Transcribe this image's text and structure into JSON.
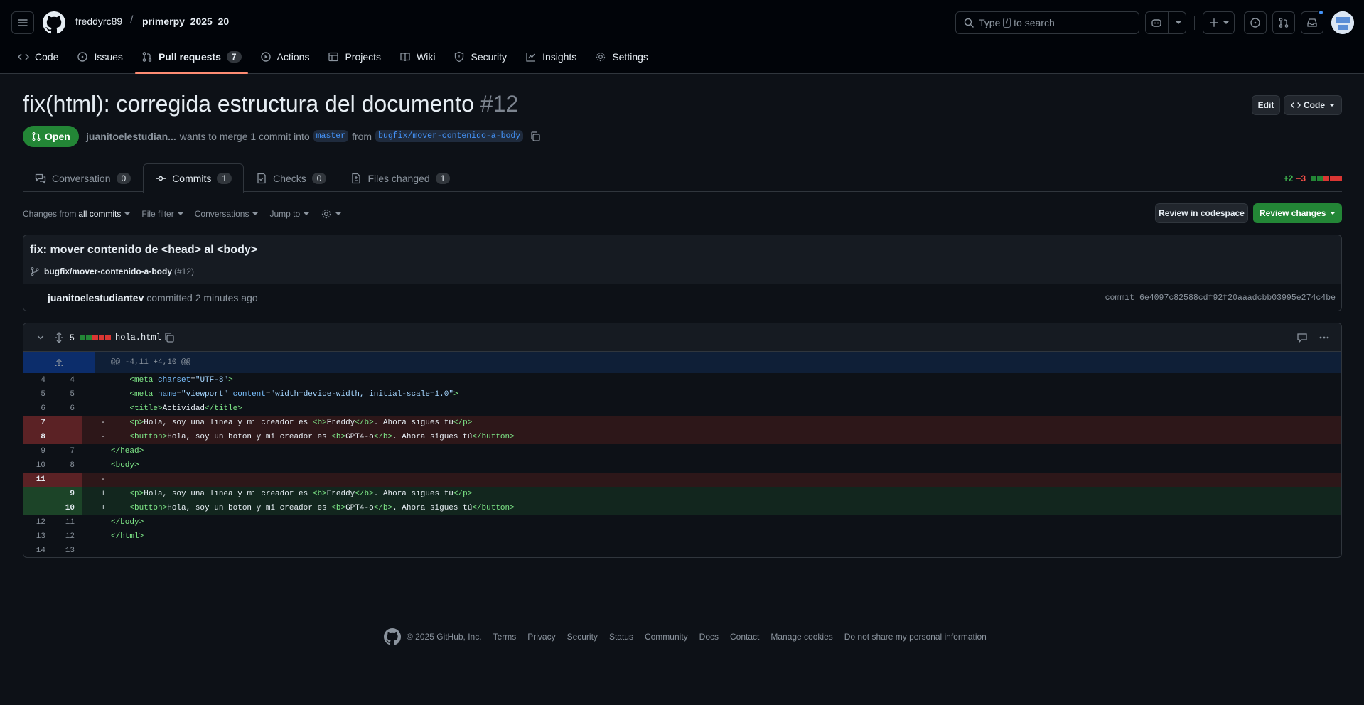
{
  "header": {
    "owner": "freddyrc89",
    "separator": "/",
    "repo": "primerpy_2025_20",
    "search": {
      "prefix": "Type",
      "key": "/",
      "suffix": "to search"
    }
  },
  "repo_nav": [
    {
      "label": "Code",
      "icon": "code-icon"
    },
    {
      "label": "Issues",
      "icon": "issue-icon"
    },
    {
      "label": "Pull requests",
      "icon": "pull-request-icon",
      "count": "7",
      "active": true
    },
    {
      "label": "Actions",
      "icon": "play-icon"
    },
    {
      "label": "Projects",
      "icon": "table-icon"
    },
    {
      "label": "Wiki",
      "icon": "book-icon"
    },
    {
      "label": "Security",
      "icon": "shield-icon"
    },
    {
      "label": "Insights",
      "icon": "graph-icon"
    },
    {
      "label": "Settings",
      "icon": "gear-icon"
    }
  ],
  "pr": {
    "title": "fix(html): corregida estructura del documento",
    "number": "#12",
    "edit_label": "Edit",
    "code_label": "Code",
    "state": "Open",
    "author": "juanitoelestudian...",
    "meta_text": "wants to merge 1 commit into",
    "base_branch": "master",
    "from_text": "from",
    "head_branch": "bugfix/mover-contenido-a-body"
  },
  "tabs": [
    {
      "label": "Conversation",
      "count": "0",
      "icon": "comment-discussion-icon"
    },
    {
      "label": "Commits",
      "count": "1",
      "icon": "commit-icon",
      "active": true
    },
    {
      "label": "Checks",
      "count": "0",
      "icon": "checklist-icon"
    },
    {
      "label": "Files changed",
      "count": "1",
      "icon": "file-diff-icon"
    }
  ],
  "diffstat": {
    "additions": "+2",
    "deletions": "−3"
  },
  "toolbar": {
    "changes_prefix": "Changes from",
    "changes_value": "all commits",
    "file_filter": "File filter",
    "conversations": "Conversations",
    "jump_to": "Jump to",
    "review_codespace": "Review in codespace",
    "review_changes": "Review changes"
  },
  "commit": {
    "message": "fix: mover contenido de <head> al <body>",
    "branch": "bugfix/mover-contenido-a-body",
    "pr_ref": "(#12)",
    "author": "juanitoelestudiantev",
    "action": "committed 2 minutes ago",
    "sha": "commit 6e4097c82588cdf92f20aaadcbb03995e274c4be"
  },
  "file": {
    "change_count": "5",
    "name": "hola.html",
    "hunk_header": "@@ -4,11 +4,10 @@"
  },
  "diff_rows": [
    {
      "type": "ctx",
      "old": "4",
      "new": "4",
      "html": "    <span class=\"tg\">&lt;meta</span> <span class=\"at\">charset</span>=<span class=\"st\">\"UTF-8\"</span><span class=\"tg\">&gt;</span>"
    },
    {
      "type": "ctx",
      "old": "5",
      "new": "5",
      "html": "    <span class=\"tg\">&lt;meta</span> <span class=\"at\">name</span>=<span class=\"st\">\"viewport\"</span> <span class=\"at\">content</span>=<span class=\"st\">\"width=device-width, initial-scale=1.0\"</span><span class=\"tg\">&gt;</span>"
    },
    {
      "type": "ctx",
      "old": "6",
      "new": "6",
      "html": "    <span class=\"tg\">&lt;title&gt;</span>Actividad<span class=\"tg\">&lt;/title&gt;</span>"
    },
    {
      "type": "del",
      "old": "7",
      "new": "",
      "html": "    <span class=\"tg\">&lt;p&gt;</span>Hola, soy una linea y mi creador es <span class=\"tg\">&lt;b&gt;</span>Freddy<span class=\"tg\">&lt;/b&gt;</span>. Ahora sigues tú<span class=\"tg\">&lt;/p&gt;</span>"
    },
    {
      "type": "del",
      "old": "8",
      "new": "",
      "html": "    <span class=\"tg\">&lt;button&gt;</span>Hola, soy un boton y mi creador es <span class=\"tg\">&lt;b&gt;</span>GPT4-o<span class=\"tg\">&lt;/b&gt;</span>. Ahora sigues tú<span class=\"tg\">&lt;/button&gt;</span>"
    },
    {
      "type": "ctx",
      "old": "9",
      "new": "7",
      "html": "<span class=\"tg\">&lt;/head&gt;</span>"
    },
    {
      "type": "ctx",
      "old": "10",
      "new": "8",
      "html": "<span class=\"tg\">&lt;body&gt;</span>"
    },
    {
      "type": "del",
      "old": "11",
      "new": "",
      "html": ""
    },
    {
      "type": "add",
      "old": "",
      "new": "9",
      "html": "    <span class=\"tg\">&lt;p&gt;</span>Hola, soy una linea y mi creador es <span class=\"tg\">&lt;b&gt;</span>Freddy<span class=\"tg\">&lt;/b&gt;</span>. Ahora sigues tú<span class=\"tg\">&lt;/p&gt;</span>"
    },
    {
      "type": "add",
      "old": "",
      "new": "10",
      "html": "    <span class=\"tg\">&lt;button&gt;</span>Hola, soy un boton y mi creador es <span class=\"tg\">&lt;b&gt;</span>GPT4-o<span class=\"tg\">&lt;/b&gt;</span>. Ahora sigues tú<span class=\"tg\">&lt;/button&gt;</span>"
    },
    {
      "type": "ctx",
      "old": "12",
      "new": "11",
      "html": "<span class=\"tg\">&lt;/body&gt;</span>"
    },
    {
      "type": "ctx",
      "old": "13",
      "new": "12",
      "html": "<span class=\"tg\">&lt;/html&gt;</span>"
    },
    {
      "type": "ctx",
      "old": "14",
      "new": "13",
      "html": ""
    }
  ],
  "footer": {
    "copyright": "© 2025 GitHub, Inc.",
    "links": [
      "Terms",
      "Privacy",
      "Security",
      "Status",
      "Community",
      "Docs",
      "Contact",
      "Manage cookies",
      "Do not share my personal information"
    ]
  },
  "colors": {
    "accent": "#238636",
    "link": "#4493f8",
    "underline": "#fd8c73",
    "deleted": "#f85149",
    "added": "#3fb950"
  }
}
